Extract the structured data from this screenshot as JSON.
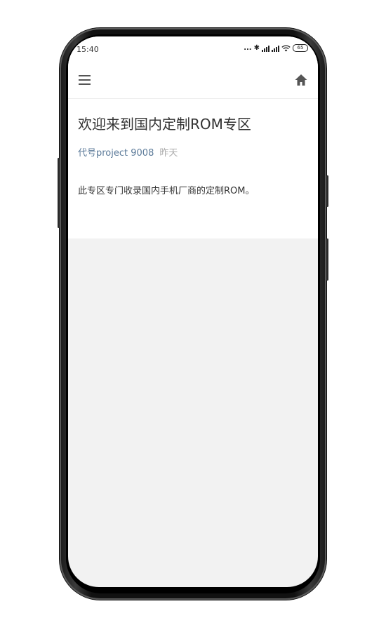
{
  "status_bar": {
    "time": "15:40",
    "dots": "...",
    "bluetooth": "✱",
    "battery": "65"
  },
  "app_bar": {
    "menu_icon": "menu-icon",
    "home_icon": "home-icon"
  },
  "article": {
    "title": "欢迎来到国内定制ROM专区",
    "author": "代号project 9008",
    "date": "昨天",
    "body": "此专区专门收录国内手机厂商的定制ROM。"
  }
}
